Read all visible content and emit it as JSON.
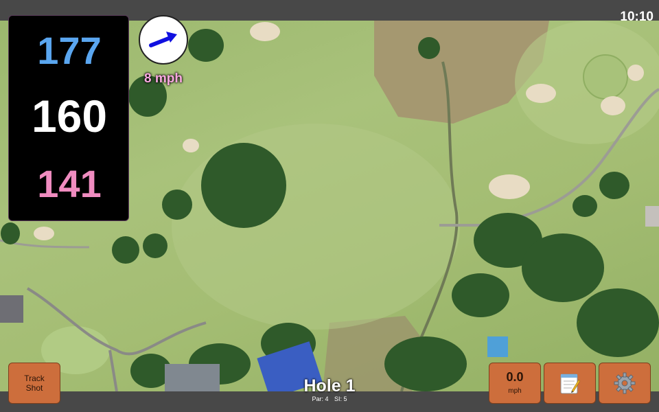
{
  "status_bar": {
    "time": "10:10"
  },
  "distances": {
    "back": "177",
    "center": "160",
    "front": "141"
  },
  "wind": {
    "speed_label": "8 mph",
    "direction": "east-northeast",
    "arrow_color": "#1010e0"
  },
  "hole": {
    "title": "Hole 1",
    "par_label": "Par: 4",
    "stroke_index_label": "SI: 5"
  },
  "buttons": {
    "track_shot_line1": "Track",
    "track_shot_line2": "Shot",
    "speed_value": "0.0",
    "speed_unit": "mph",
    "notes_icon": "notepad-icon",
    "settings_icon": "gear-icon"
  },
  "colors": {
    "back_distance": "#5aa6f0",
    "center_distance": "#ffffff",
    "front_distance": "#f08cc0",
    "button_bg": "#cd6e3c"
  }
}
